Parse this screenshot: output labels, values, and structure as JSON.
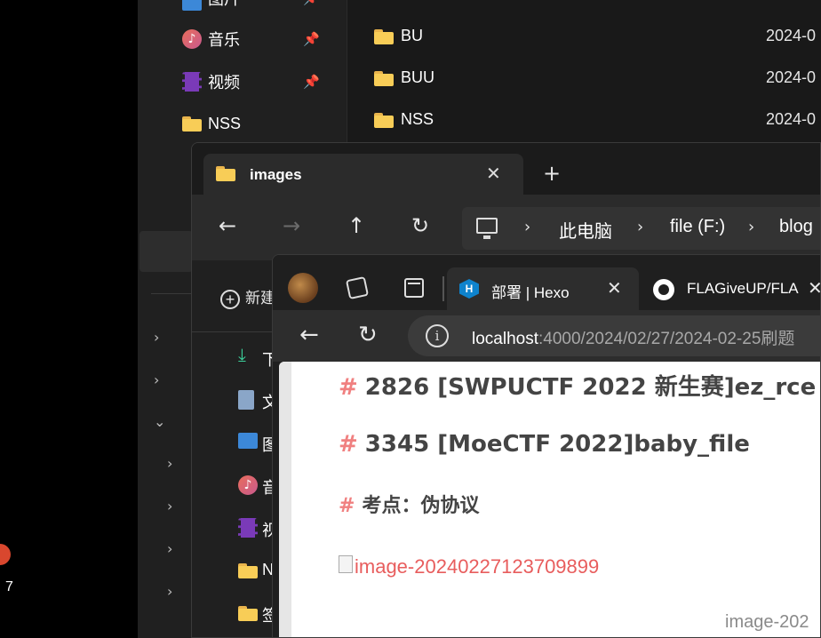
{
  "desktop": {
    "label": "7"
  },
  "explorer_back": {
    "nav_items": [
      {
        "label": "图片",
        "icon": "pictures-icon",
        "pinned": true
      },
      {
        "label": "音乐",
        "icon": "music-icon",
        "pinned": true
      },
      {
        "label": "视频",
        "icon": "videos-icon",
        "pinned": true
      },
      {
        "label": "NSS",
        "icon": "folder-icon",
        "pinned": false
      }
    ],
    "files": [
      {
        "name": "BU",
        "date": "2024-0"
      },
      {
        "name": "BUU",
        "date": "2024-0"
      },
      {
        "name": "NSS",
        "date": "2024-0"
      }
    ]
  },
  "explorer_front": {
    "tab_label": "images",
    "breadcrumbs": [
      "此电脑",
      "file (F:)",
      "blog"
    ],
    "new_label": "新建",
    "side_items": [
      {
        "label": "下",
        "icon": "download-icon"
      },
      {
        "label": "文",
        "icon": "documents-icon"
      },
      {
        "label": "图",
        "icon": "pictures-icon"
      },
      {
        "label": "音",
        "icon": "music-icon"
      },
      {
        "label": "视",
        "icon": "videos-icon"
      },
      {
        "label": "N",
        "icon": "folder-icon"
      },
      {
        "label": "签",
        "icon": "folder-icon"
      }
    ]
  },
  "browser": {
    "tabs": [
      {
        "label": "部署 | Hexo",
        "icon": "hexo-icon",
        "active": true
      },
      {
        "label": "FLAGiveUP/FLA",
        "icon": "github-icon",
        "active": false
      }
    ],
    "url_host": "localhost",
    "url_path": ":4000/2024/02/27/2024-02-25刷题",
    "page": {
      "hash": "#",
      "heading1": "2826 [SWPUCTF 2022 新生赛]ez_rce",
      "heading2": "3345 [MoeCTF 2022]baby_file",
      "heading3": "考点：伪协议",
      "image_alt": "image-20240227123709899",
      "image_caption": "image-202"
    }
  },
  "colors": {
    "accent_hash": "#f08080",
    "link_red": "#e85d5d",
    "folder_yellow": "#f8cd57"
  }
}
